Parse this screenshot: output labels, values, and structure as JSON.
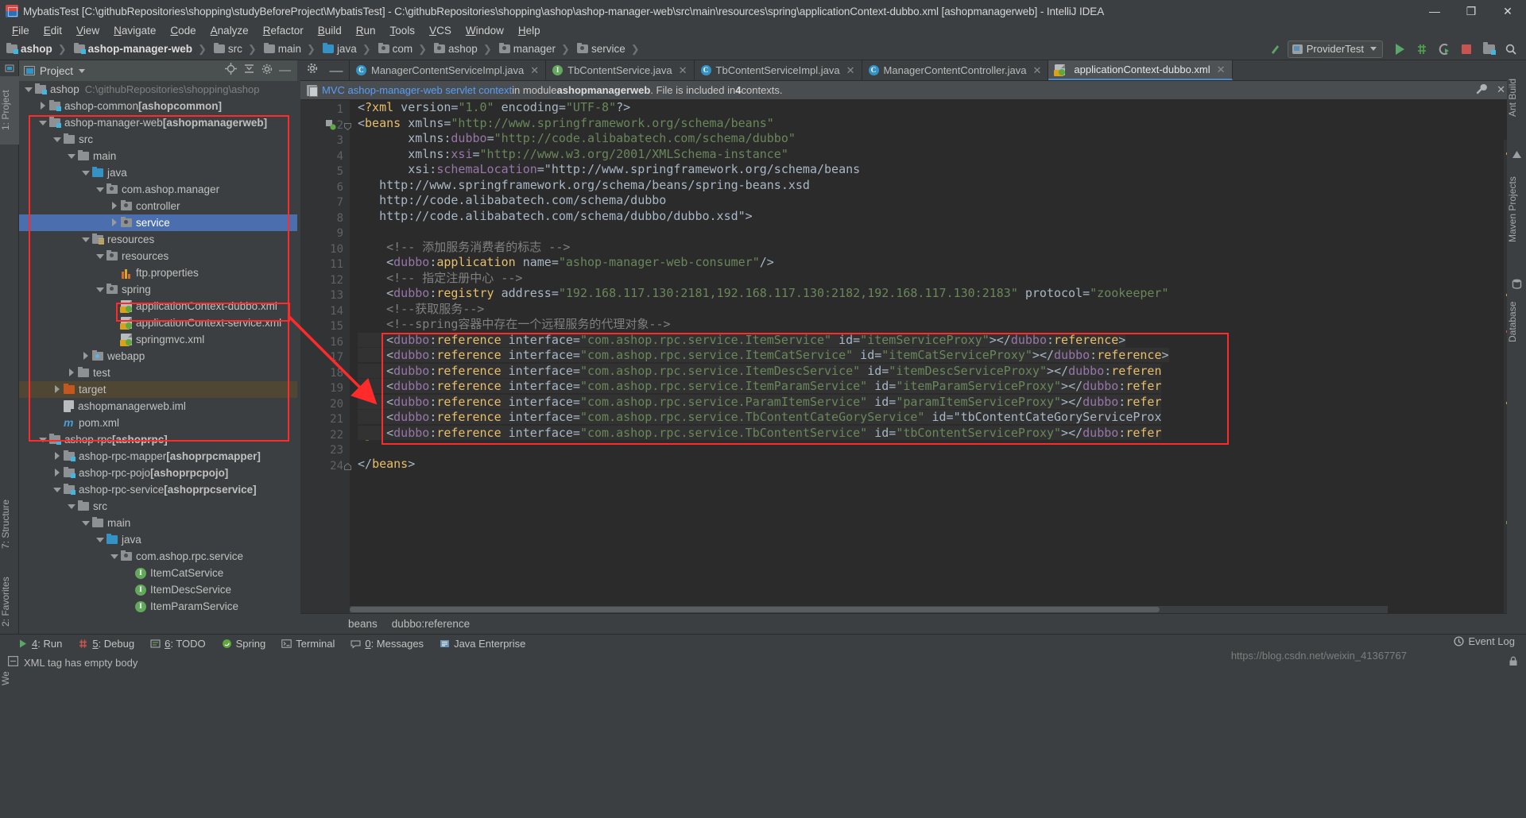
{
  "window": {
    "title": "MybatisTest [C:\\githubRepositories\\shopping\\studyBeforeProject\\MybatisTest] - C:\\githubRepositories\\shopping\\ashop\\ashop-manager-web\\src\\main\\resources\\spring\\applicationContext-dubbo.xml [ashopmanagerweb] - IntelliJ IDEA",
    "minimize": "—",
    "maximize": "❐",
    "close": "✕"
  },
  "menubar": {
    "items": [
      "File",
      "Edit",
      "View",
      "Navigate",
      "Code",
      "Analyze",
      "Refactor",
      "Build",
      "Run",
      "Tools",
      "VCS",
      "Window",
      "Help"
    ]
  },
  "navbar": {
    "crumbs": [
      {
        "label": "ashop",
        "icon": "module-folder-icon",
        "bold": true
      },
      {
        "label": "ashop-manager-web",
        "icon": "module-folder-icon",
        "bold": true
      },
      {
        "label": "src",
        "icon": "folder-icon",
        "bold": false
      },
      {
        "label": "main",
        "icon": "folder-icon",
        "bold": false
      },
      {
        "label": "java",
        "icon": "source-folder-icon",
        "bold": false
      },
      {
        "label": "com",
        "icon": "package-icon",
        "bold": false
      },
      {
        "label": "ashop",
        "icon": "package-icon",
        "bold": false
      },
      {
        "label": "manager",
        "icon": "package-icon",
        "bold": false
      },
      {
        "label": "service",
        "icon": "package-icon",
        "bold": false
      }
    ],
    "run_config": "ProviderTest",
    "icons": [
      "make-project-icon",
      "run-icon",
      "debug-icon",
      "run-with-coverage-icon",
      "stop-icon",
      "project-structure-icon",
      "search-everywhere-icon"
    ]
  },
  "left_tool_strip": {
    "tabs": [
      "1: Project",
      "7: Structure",
      "2: Favorites",
      "Web"
    ]
  },
  "right_tool_strip": {
    "tabs": [
      "Ant Build",
      "Maven Projects",
      "Database"
    ]
  },
  "project_panel": {
    "title": "Project",
    "header_icons": [
      "locate-icon",
      "collapse-all-icon",
      "settings-icon",
      "hide-icon"
    ],
    "tree": [
      {
        "depth": 0,
        "arrow": "down",
        "icon": "module-icon",
        "label": "ashop",
        "bold": true,
        "path": "C:\\githubRepositories\\shopping\\ashop"
      },
      {
        "depth": 1,
        "arrow": "right",
        "icon": "module-icon",
        "label": "ashop-common ",
        "suffix": "[ashopcommon]"
      },
      {
        "depth": 1,
        "arrow": "down",
        "icon": "module-icon",
        "label": "ashop-manager-web ",
        "suffix": "[ashopmanagerweb]"
      },
      {
        "depth": 2,
        "arrow": "down",
        "icon": "folder-icon",
        "label": "src"
      },
      {
        "depth": 3,
        "arrow": "down",
        "icon": "folder-icon",
        "label": "main"
      },
      {
        "depth": 4,
        "arrow": "down",
        "icon": "source-folder-icon",
        "label": "java"
      },
      {
        "depth": 5,
        "arrow": "down",
        "icon": "package-icon",
        "label": "com.ashop.manager"
      },
      {
        "depth": 6,
        "arrow": "right",
        "icon": "package-icon",
        "label": "controller"
      },
      {
        "depth": 6,
        "arrow": "right",
        "icon": "package-icon",
        "label": "service",
        "selected": true
      },
      {
        "depth": 4,
        "arrow": "down",
        "icon": "resource-folder-icon",
        "label": "resources"
      },
      {
        "depth": 5,
        "arrow": "down",
        "icon": "package-icon",
        "label": "resources"
      },
      {
        "depth": 6,
        "arrow": "none",
        "icon": "properties-icon",
        "label": "ftp.properties"
      },
      {
        "depth": 5,
        "arrow": "down",
        "icon": "package-icon",
        "label": "spring"
      },
      {
        "depth": 6,
        "arrow": "none",
        "icon": "spring-xml-icon",
        "label": "applicationContext-dubbo.xml",
        "highlight": true
      },
      {
        "depth": 6,
        "arrow": "none",
        "icon": "spring-xml-icon",
        "label": "applicationContext-service.xml"
      },
      {
        "depth": 6,
        "arrow": "none",
        "icon": "spring-xml-icon",
        "label": "springmvc.xml"
      },
      {
        "depth": 4,
        "arrow": "right",
        "icon": "webapp-folder-icon",
        "label": "webapp"
      },
      {
        "depth": 3,
        "arrow": "right",
        "icon": "folder-icon",
        "label": "test"
      },
      {
        "depth": 2,
        "arrow": "right",
        "icon": "target-folder-icon",
        "label": "target",
        "excluded": true
      },
      {
        "depth": 2,
        "arrow": "none",
        "icon": "iml-file-icon",
        "label": "ashopmanagerweb.iml"
      },
      {
        "depth": 2,
        "arrow": "none",
        "icon": "maven-icon",
        "label": "pom.xml"
      },
      {
        "depth": 1,
        "arrow": "down",
        "icon": "module-icon",
        "label": "ashop-rpc ",
        "suffix": "[ashoprpc]"
      },
      {
        "depth": 2,
        "arrow": "right",
        "icon": "module-icon",
        "label": "ashop-rpc-mapper ",
        "suffix": "[ashoprpcmapper]"
      },
      {
        "depth": 2,
        "arrow": "right",
        "icon": "module-icon",
        "label": "ashop-rpc-pojo ",
        "suffix": "[ashoprpcpojo]"
      },
      {
        "depth": 2,
        "arrow": "down",
        "icon": "module-icon",
        "label": "ashop-rpc-service ",
        "suffix": "[ashoprpcservice]"
      },
      {
        "depth": 3,
        "arrow": "down",
        "icon": "folder-icon",
        "label": "src"
      },
      {
        "depth": 4,
        "arrow": "down",
        "icon": "folder-icon",
        "label": "main"
      },
      {
        "depth": 5,
        "arrow": "down",
        "icon": "source-folder-icon",
        "label": "java"
      },
      {
        "depth": 6,
        "arrow": "down",
        "icon": "package-icon",
        "label": "com.ashop.rpc.service"
      },
      {
        "depth": 7,
        "arrow": "none",
        "icon": "interface-icon",
        "label": "ItemCatService"
      },
      {
        "depth": 7,
        "arrow": "none",
        "icon": "interface-icon",
        "label": "ItemDescService"
      },
      {
        "depth": 7,
        "arrow": "none",
        "icon": "interface-icon",
        "label": "ItemParamService"
      }
    ]
  },
  "editor": {
    "tabs": [
      {
        "label": "ManagerContentServiceImpl.java",
        "badge": "C",
        "active": false
      },
      {
        "label": "TbContentService.java",
        "badge": "I",
        "active": false
      },
      {
        "label": "TbContentServiceImpl.java",
        "badge": "C",
        "active": false
      },
      {
        "label": "ManagerContentController.java",
        "badge": "C",
        "active": false
      },
      {
        "label": "applicationContext-dubbo.xml",
        "badge": "X",
        "active": true
      }
    ],
    "context_bar": {
      "link": "MVC ashop-manager-web servlet context",
      "mid": " in module ",
      "module": "ashopmanagerweb",
      "tail": ". File is included in ",
      "count": "4",
      "tail2": " contexts."
    },
    "breadcrumbs": [
      "beans",
      "dubbo:reference"
    ],
    "line_numbers": [
      "1",
      "2",
      "3",
      "4",
      "5",
      "6",
      "7",
      "8",
      "9",
      "10",
      "11",
      "12",
      "13",
      "14",
      "15",
      "16",
      "17",
      "18",
      "19",
      "20",
      "21",
      "22",
      "23",
      "24"
    ]
  },
  "code_lines": [
    "<?xml version=\"1.0\" encoding=\"UTF-8\"?>",
    "<beans xmlns=\"http://www.springframework.org/schema/beans\"",
    "       xmlns:dubbo=\"http://code.alibabatech.com/schema/dubbo\"",
    "       xmlns:xsi=\"http://www.w3.org/2001/XMLSchema-instance\"",
    "       xsi:schemaLocation=\"http://www.springframework.org/schema/beans",
    "   http://www.springframework.org/schema/beans/spring-beans.xsd",
    "   http://code.alibabatech.com/schema/dubbo",
    "   http://code.alibabatech.com/schema/dubbo/dubbo.xsd\">",
    "",
    "    <!-- 添加服务消费者的标志 -->",
    "    <dubbo:application name=\"ashop-manager-web-consumer\"/>",
    "    <!-- 指定注册中心 -->",
    "    <dubbo:registry address=\"192.168.117.130:2181,192.168.117.130:2182,192.168.117.130:2183\" protocol=\"zookeeper\"",
    "    <!--获取服务-->",
    "    <!--spring容器中存在一个远程服务的代理对象-->",
    "    <dubbo:reference interface=\"com.ashop.rpc.service.ItemService\" id=\"itemServiceProxy\"></dubbo:reference>",
    "    <dubbo:reference interface=\"com.ashop.rpc.service.ItemCatService\" id=\"itemCatServiceProxy\"></dubbo:reference>",
    "    <dubbo:reference interface=\"com.ashop.rpc.service.ItemDescService\" id=\"itemDescServiceProxy\"></dubbo:referen",
    "    <dubbo:reference interface=\"com.ashop.rpc.service.ItemParamService\" id=\"itemParamServiceProxy\"></dubbo:refer",
    "    <dubbo:reference interface=\"com.ashop.rpc.service.ParamItemService\" id=\"paramItemServiceProxy\"></dubbo:refer",
    "    <dubbo:reference interface=\"com.ashop.rpc.service.TbContentCateGoryService\" id=\"tbContentCateGoryServiceProx",
    "    <dubbo:reference interface=\"com.ashop.rpc.service.TbContentService\" id=\"tbContentServiceProxy\"></dubbo:refer",
    "",
    "</beans>"
  ],
  "bottom_bar": {
    "buttons": [
      {
        "icon": "run-icon",
        "label": "4: Run",
        "underline": "4"
      },
      {
        "icon": "debug-icon",
        "label": "5: Debug",
        "underline": "5"
      },
      {
        "icon": "todo-icon",
        "label": "6: TODO",
        "underline": "6"
      },
      {
        "icon": "spring-icon",
        "label": "Spring",
        "underline": ""
      },
      {
        "icon": "terminal-icon",
        "label": "Terminal",
        "underline": ""
      },
      {
        "icon": "messages-icon",
        "label": "0: Messages",
        "underline": "0"
      },
      {
        "icon": "java-enterprise-icon",
        "label": "Java Enterprise",
        "underline": ""
      }
    ],
    "event_log": "Event Log"
  },
  "status_bar": {
    "message": "XML tag has empty body",
    "watermark": "https://blog.csdn.net/weixin_41367767"
  },
  "colors": {
    "accent_blue": "#4b6eaf",
    "annotation_red": "#ff2b2b",
    "link_blue": "#589df6",
    "string_green": "#6a8759",
    "tag_orange": "#e8bf6a",
    "ns_purple": "#9876aa",
    "editor_bg": "#2b2b2b",
    "panel_bg": "#3c3f41"
  }
}
